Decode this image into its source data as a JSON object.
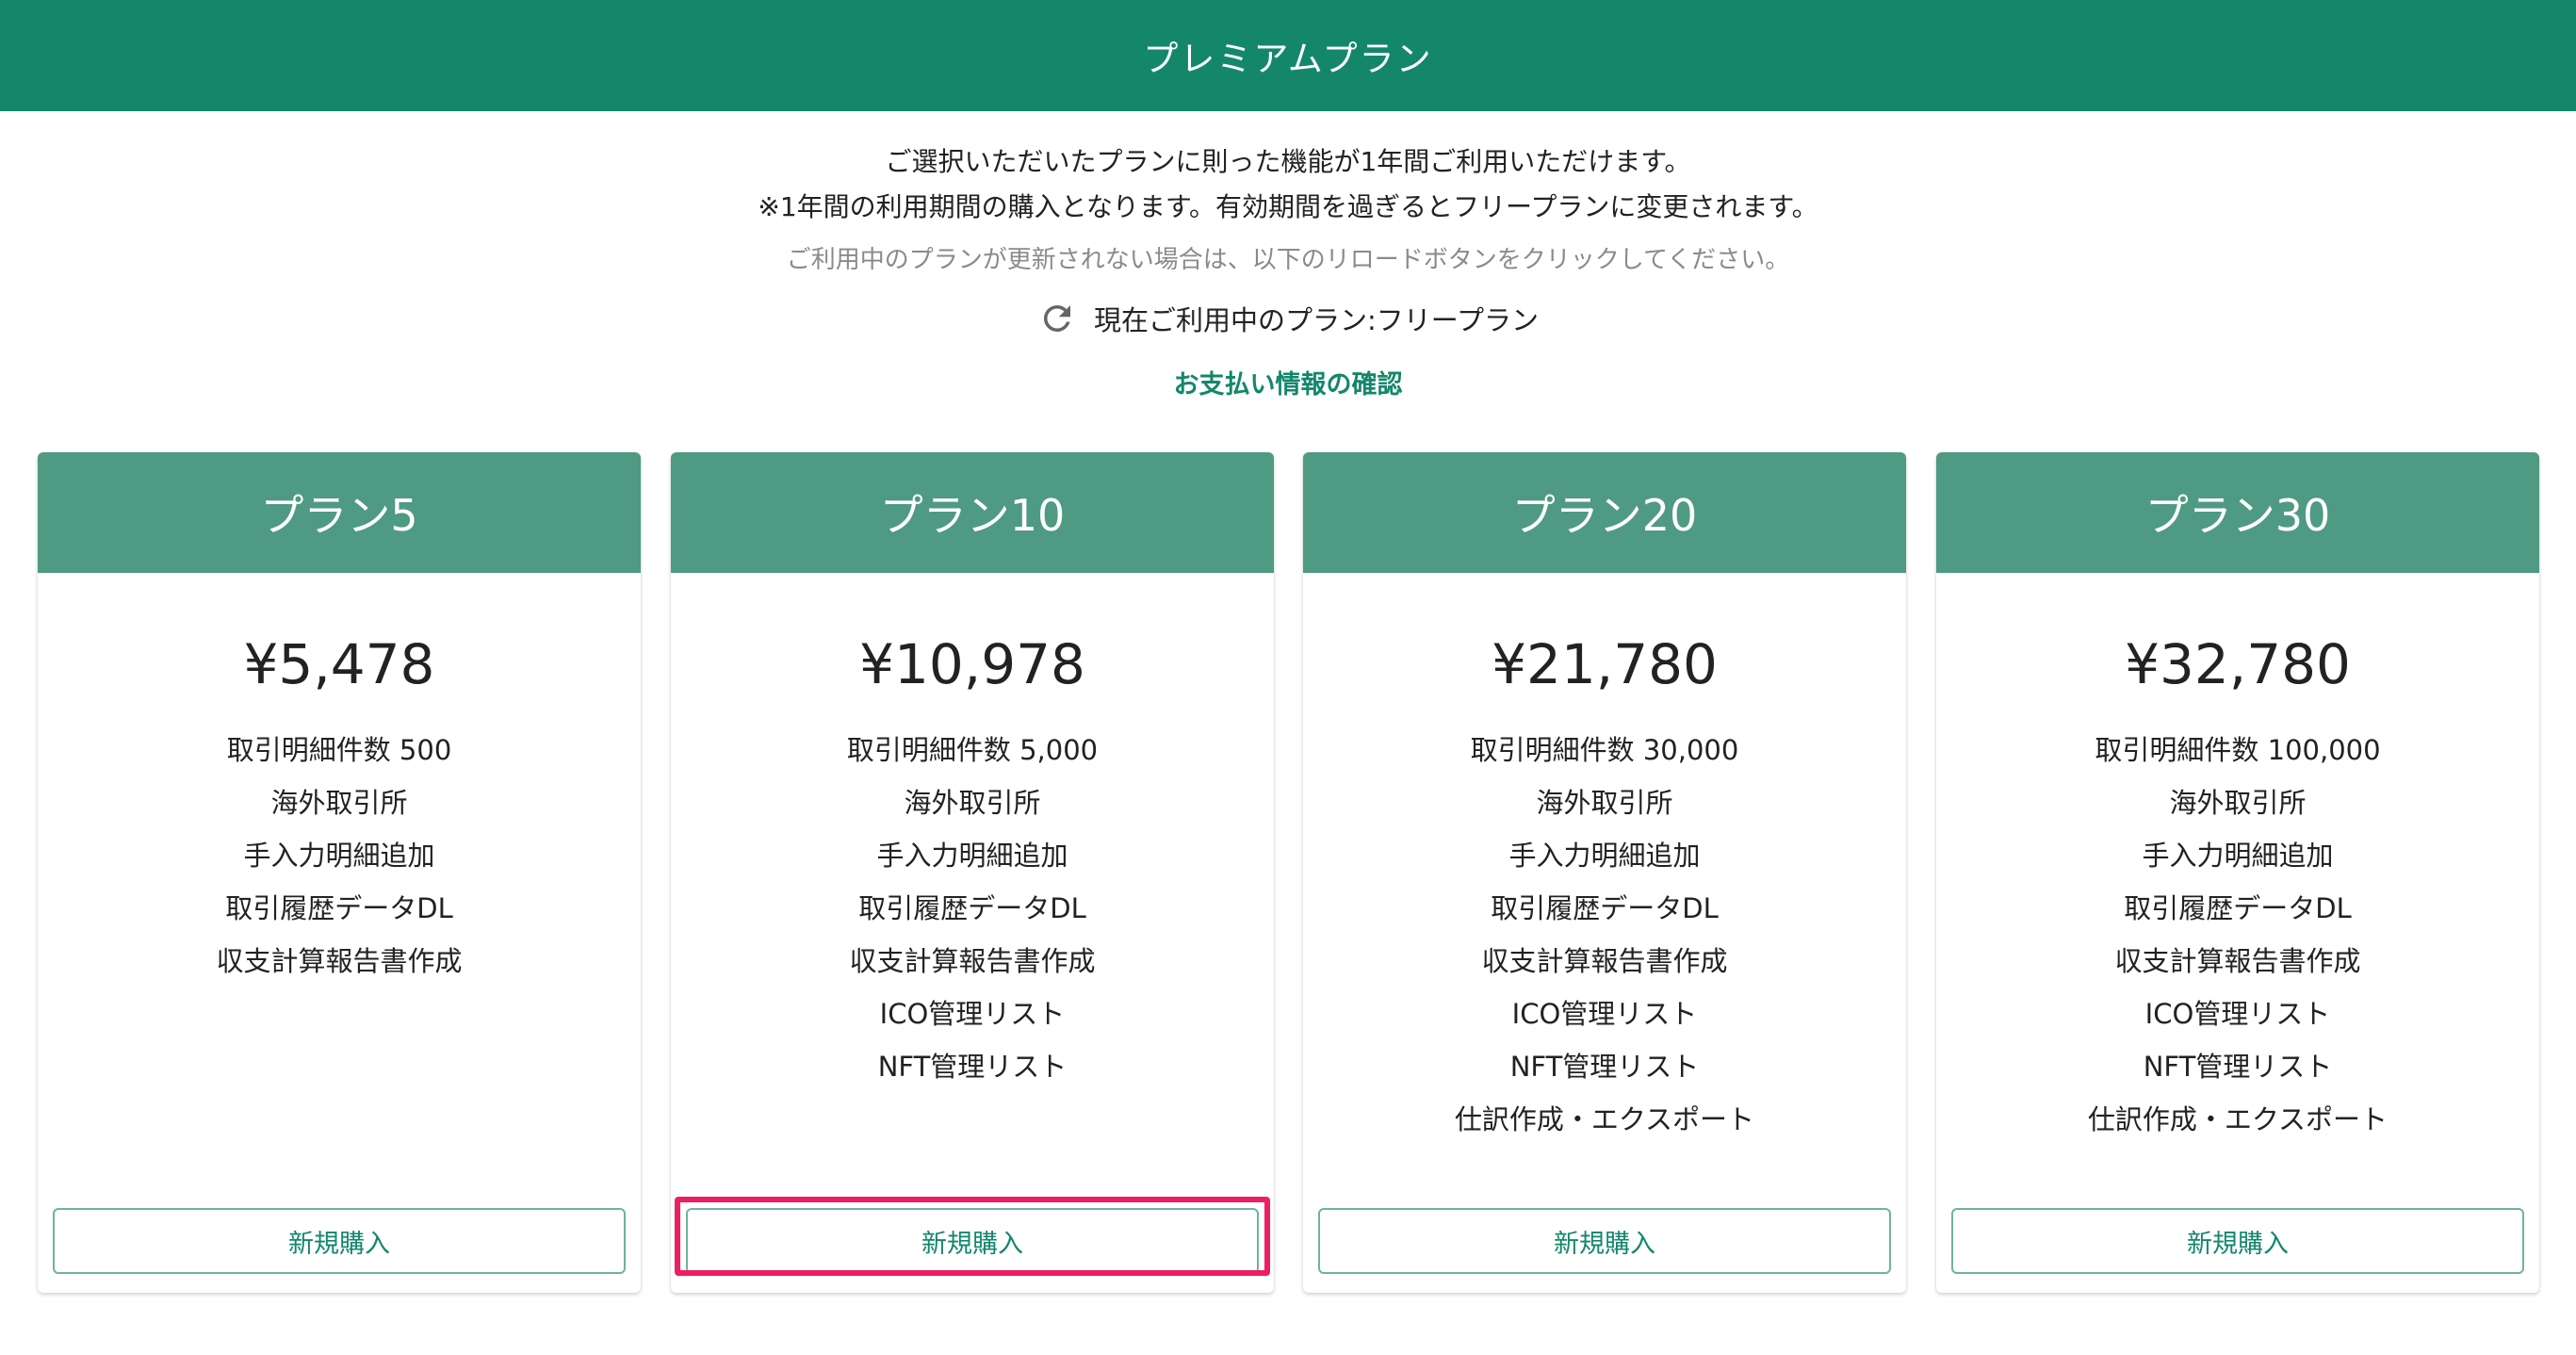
{
  "header": {
    "title": "プレミアムプラン"
  },
  "info": {
    "line1": "ご選択いただいたプランに則った機能が1年間ご利用いただけます。",
    "line2": "※1年間の利用期間の購入となります。有効期間を過ぎるとフリープランに変更されます。",
    "note": "ご利用中のプランが更新されない場合は、以下のリロードボタンをクリックしてください。",
    "current_plan": "現在ご利用中のプラン:フリープラン",
    "payment_link": "お支払い情報の確認"
  },
  "plans": [
    {
      "name": "プラン5",
      "price": "¥5,478",
      "features": [
        "取引明細件数 500",
        "海外取引所",
        "手入力明細追加",
        "取引履歴データDL",
        "収支計算報告書作成"
      ],
      "button": "新規購入"
    },
    {
      "name": "プラン10",
      "price": "¥10,978",
      "features": [
        "取引明細件数 5,000",
        "海外取引所",
        "手入力明細追加",
        "取引履歴データDL",
        "収支計算報告書作成",
        "ICO管理リスト",
        "NFT管理リスト"
      ],
      "button": "新規購入"
    },
    {
      "name": "プラン20",
      "price": "¥21,780",
      "features": [
        "取引明細件数 30,000",
        "海外取引所",
        "手入力明細追加",
        "取引履歴データDL",
        "収支計算報告書作成",
        "ICO管理リスト",
        "NFT管理リスト",
        "仕訳作成・エクスポート"
      ],
      "button": "新規購入"
    },
    {
      "name": "プラン30",
      "price": "¥32,780",
      "features": [
        "取引明細件数 100,000",
        "海外取引所",
        "手入力明細追加",
        "取引履歴データDL",
        "収支計算報告書作成",
        "ICO管理リスト",
        "NFT管理リスト",
        "仕訳作成・エクスポート"
      ],
      "button": "新規購入"
    }
  ],
  "colors": {
    "header": "#14876b",
    "card_header": "#4f9a83",
    "accent": "#14876b",
    "highlight": "#ec1f63"
  },
  "icons": {
    "reload": "reload-icon"
  }
}
